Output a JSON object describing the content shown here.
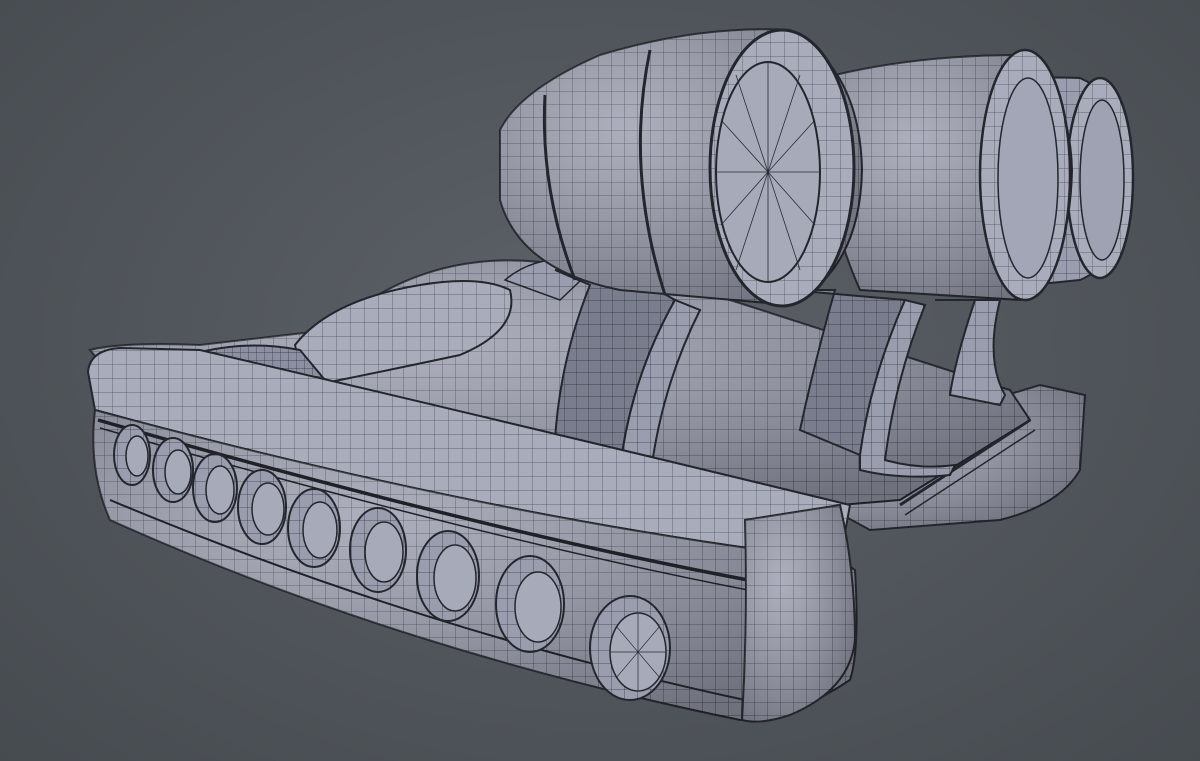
{
  "scene": {
    "subject": "wireframe-hovercraft-model",
    "background_color": "#50555b",
    "surface_color": "#9a9dae",
    "wire_color": "#2a2c33",
    "shadow_color": "#6e7182",
    "side_fan_count": 9,
    "rear_engine_count": 3
  }
}
